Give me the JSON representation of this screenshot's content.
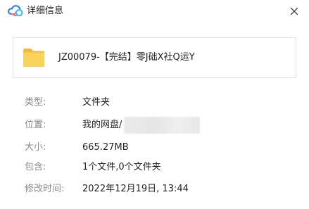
{
  "window": {
    "title": "详细信息",
    "logo_icon": "baidu-netdisk-logo-icon",
    "close_icon": "close-icon"
  },
  "file": {
    "icon": "folder-icon",
    "name": "JZ00079-【完结】零J础X社Q运Y"
  },
  "properties": [
    {
      "label": "类型:",
      "value": "文件夹"
    },
    {
      "label": "位置:",
      "value": "我的网盘/"
    },
    {
      "label": "大小:",
      "value": "665.27MB"
    },
    {
      "label": "包含:",
      "value": "1个文件,0个文件夹"
    },
    {
      "label": "修改时间:",
      "value": "2022年12月19日, 13:44"
    }
  ],
  "colors": {
    "label": "#8a8a8a",
    "value": "#1f1f1f",
    "folder": "#f7c948",
    "logo_blue": "#2f80ed"
  }
}
